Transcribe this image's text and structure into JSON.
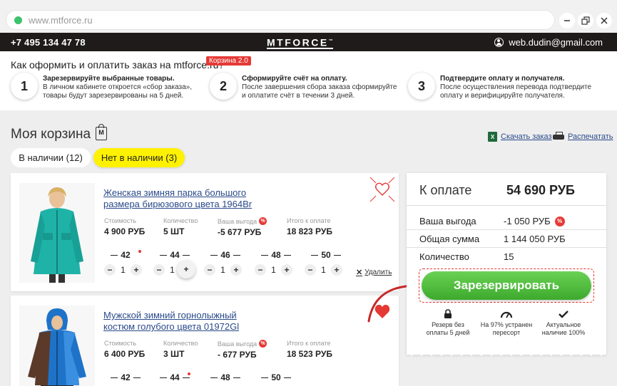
{
  "browser": {
    "url": "www.mtforce.ru"
  },
  "header": {
    "phone": "+7 495 134 47 78",
    "logo": "MTFORCE",
    "logo_tm": "™",
    "email": "web.dudin@gmail.com"
  },
  "howto": {
    "title": "Как оформить и оплатить заказ на mtforce.ru?",
    "badge": "Корзина 2.0",
    "steps": [
      {
        "num": "1",
        "title": "Зарезервируйте выбранные товары.",
        "line1": "В личном кабинете откроется «сбор заказа»,",
        "line2": "товары будут зарезервированы на 5 дней."
      },
      {
        "num": "2",
        "title": "Сформируйте счёт на оплату.",
        "line1": "После завершения сбора заказа сформируйте",
        "line2": "и оплатите счёт в течении 3 дней."
      },
      {
        "num": "3",
        "title": "Подтвердите оплату и получателя.",
        "line1": "После осуществления перевода подтвердите",
        "line2": "оплату и верифицируйте получателя."
      }
    ]
  },
  "cart": {
    "title": "Моя корзина",
    "bag_letter": "M",
    "export_label": "Скачать заказ",
    "print_label": "Распечатать",
    "tabs": [
      {
        "label": "В наличии (12)"
      },
      {
        "label": "Нет в наличии (3)"
      }
    ],
    "field_labels": {
      "price": "Стоимость",
      "qty": "Количество",
      "savings": "Ваша выгода",
      "total": "Итого к оплате"
    },
    "remove_label": "Удалить",
    "items": [
      {
        "name": "Женская зимняя парка большого размера бирюзового цвета 1964Br",
        "price": "4 900 РУБ",
        "qty": "5 ШТ",
        "savings": "-5 677 РУБ",
        "total": "18 823 РУБ",
        "sizes": [
          {
            "size": "42",
            "qty": "1"
          },
          {
            "size": "44",
            "qty": "1"
          },
          {
            "size": "46",
            "qty": "1"
          },
          {
            "size": "48",
            "qty": "1"
          },
          {
            "size": "50",
            "qty": "1"
          }
        ]
      },
      {
        "name": "Мужской зимний горнолыжный костюм голубого цвета 01972Gl",
        "price": "6 400 РУБ",
        "qty": "3 ШТ",
        "savings": "- 677 РУБ",
        "total": "18 523 РУБ",
        "sizes": [
          {
            "size": "42"
          },
          {
            "size": "44"
          },
          {
            "size": "48"
          },
          {
            "size": "50"
          }
        ]
      }
    ]
  },
  "summary": {
    "pay_label": "К оплате",
    "pay_value": "54 690 РУБ",
    "rows": [
      {
        "label": "Ваша выгода",
        "value": "-1 050 РУБ"
      },
      {
        "label": "Общая сумма",
        "value": "1 144 050 РУБ"
      },
      {
        "label": "Количество",
        "value": "15"
      }
    ],
    "reserve_button": "Зарезервировать",
    "features": [
      {
        "line1": "Резерв без",
        "line2": "оплаты 5 дней",
        "icon": "lock-icon"
      },
      {
        "line1": "На 97% устранен",
        "line2": "пересорт",
        "icon": "gauge-icon"
      },
      {
        "line1": "Актуальное",
        "line2": "наличие 100%",
        "icon": "check-icon"
      }
    ]
  },
  "colors": {
    "header_bg": "#1f1b1b",
    "accent_red": "#e53935",
    "tab_yellow": "#fff200",
    "button_green": "#4cbb3a",
    "link_blue": "#2a4a8a"
  }
}
